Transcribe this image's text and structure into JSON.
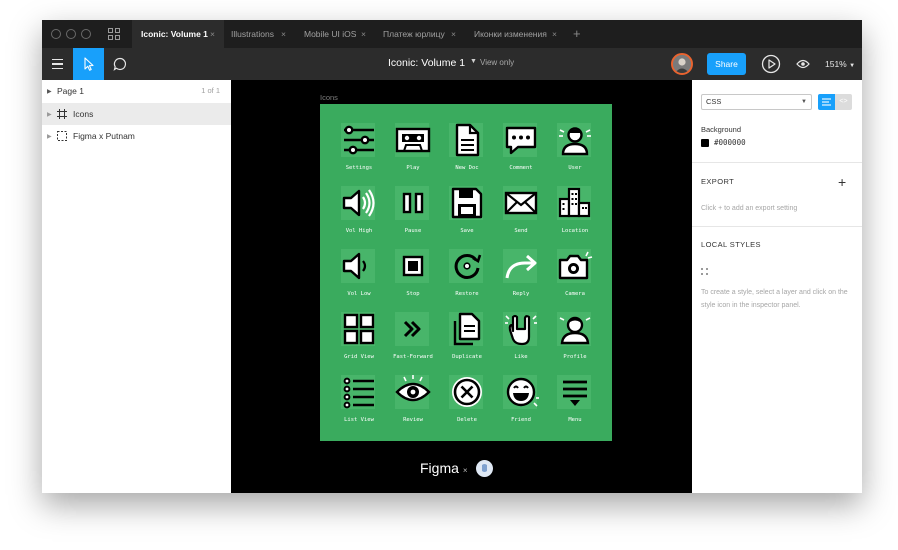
{
  "tabs": [
    {
      "label": "Iconic: Volume 1",
      "active": true
    },
    {
      "label": "Illustrations",
      "active": false
    },
    {
      "label": "Mobile UI iOS",
      "active": false
    },
    {
      "label": "Платеж юрлицу",
      "active": false
    },
    {
      "label": "Иконки изменения",
      "active": false
    }
  ],
  "tab_close": "×",
  "tab_add": "+",
  "toolbar": {
    "title": "Iconic: Volume 1",
    "view_mode": "View only",
    "share_label": "Share",
    "zoom": "151%"
  },
  "layers": {
    "page_label": "Page 1",
    "page_count": "1 of 1",
    "items": [
      {
        "name": "Icons",
        "selected": true
      },
      {
        "name": "Figma x Putnam",
        "selected": false
      }
    ]
  },
  "canvas": {
    "frame_label": "Icons",
    "icons": [
      {
        "label": "Settings",
        "icon": "sliders-icon"
      },
      {
        "label": "Play",
        "icon": "cassette-icon"
      },
      {
        "label": "New Doc",
        "icon": "document-icon"
      },
      {
        "label": "Comment",
        "icon": "speech-bubble-icon"
      },
      {
        "label": "User",
        "icon": "user-icon"
      },
      {
        "label": "Vol High",
        "icon": "volume-high-icon"
      },
      {
        "label": "Pause",
        "icon": "pause-icon"
      },
      {
        "label": "Save",
        "icon": "floppy-disk-icon"
      },
      {
        "label": "Send",
        "icon": "envelope-icon"
      },
      {
        "label": "Location",
        "icon": "city-icon"
      },
      {
        "label": "Vol Low",
        "icon": "volume-low-icon"
      },
      {
        "label": "Stop",
        "icon": "stop-icon"
      },
      {
        "label": "Restore",
        "icon": "restore-icon"
      },
      {
        "label": "Reply",
        "icon": "reply-arrow-icon"
      },
      {
        "label": "Camera",
        "icon": "camera-icon"
      },
      {
        "label": "Grid View",
        "icon": "grid-icon"
      },
      {
        "label": "Fast-Forward",
        "icon": "fast-forward-icon"
      },
      {
        "label": "Duplicate",
        "icon": "duplicate-icon"
      },
      {
        "label": "Like",
        "icon": "rock-hand-icon"
      },
      {
        "label": "Profile",
        "icon": "profile-icon"
      },
      {
        "label": "List View",
        "icon": "list-icon"
      },
      {
        "label": "Review",
        "icon": "eye-icon"
      },
      {
        "label": "Delete",
        "icon": "delete-circle-icon"
      },
      {
        "label": "Friend",
        "icon": "smiley-icon"
      },
      {
        "label": "Menu",
        "icon": "menu-icon"
      }
    ],
    "credit_left": "Figma",
    "credit_times": "×",
    "help_label": "?"
  },
  "properties": {
    "code_language": "CSS",
    "background_label": "Background",
    "background_hex": "#000000",
    "export_heading": "EXPORT",
    "export_hint": "Click + to add an export setting",
    "styles_heading": "LOCAL STYLES",
    "styles_hint": "To create a style, select a layer and click on the style icon in the inspector panel."
  },
  "colors": {
    "accent": "#18a0fb",
    "frame_green": "#3aab5e",
    "canvas_bg": "#000000",
    "chrome_dark": "#2c2c2c",
    "avatar_ring": "#e9632f"
  }
}
